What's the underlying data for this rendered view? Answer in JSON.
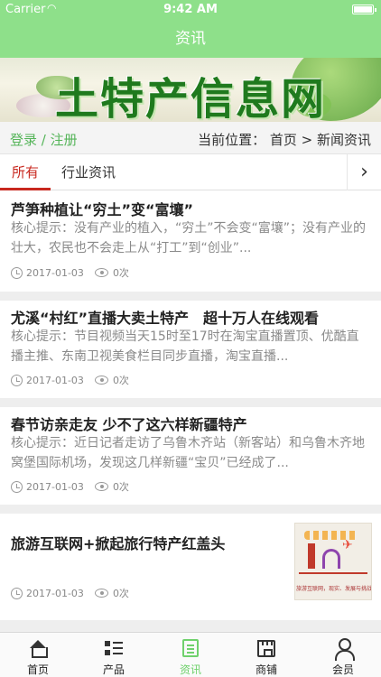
{
  "status_bar": {
    "carrier": "Carrier",
    "wifi_icon": "wifi-icon",
    "time": "9:42 AM",
    "battery_icon": "battery-icon"
  },
  "nav": {
    "title": "资讯"
  },
  "banner": {
    "text": "土特产信息网"
  },
  "subbar": {
    "login": "登录 / 注册",
    "breadcrumb": "当前位置： 首页 > 新闻资讯"
  },
  "tabs": {
    "items": [
      {
        "label": "所有",
        "active": true
      },
      {
        "label": "行业资讯",
        "active": false
      }
    ],
    "more_icon": "chevron-right-icon"
  },
  "articles": [
    {
      "title": "芦笋种植让“穷土”变“富壤”",
      "summary": "核心提示：没有产业的植入，“穷土”不会变“富壤”；没有产业的壮大，农民也不会走上从“打工”到“创业”...",
      "date": "2017-01-03",
      "views": "0次"
    },
    {
      "title": "尤溪“村红”直播大卖土特产　超十万人在线观看",
      "summary": "核心提示：节目视频当天15时至17时在淘宝直播置顶、优酷直播主推、东南卫视美食栏目同步直播，淘宝直播...",
      "date": "2017-01-03",
      "views": "0次"
    },
    {
      "title": "春节访亲走友 少不了这六样新疆特产",
      "summary": "核心提示：近日记者走访了乌鲁木齐站（新客站）和乌鲁木齐地窝堡国际机场，发现这几样新疆“宝贝”已经成了...",
      "date": "2017-01-03",
      "views": "0次"
    },
    {
      "title": "旅游互联网+掀起旅行特产红盖头",
      "date": "2017-01-03",
      "views": "0次",
      "thumb_caption": "旅游互联网，现实、发展与挑战"
    }
  ],
  "tabbar": {
    "items": [
      {
        "label": "首页",
        "icon": "home-icon",
        "active": false
      },
      {
        "label": "产品",
        "icon": "list-icon",
        "active": false
      },
      {
        "label": "资讯",
        "icon": "news-icon",
        "active": true
      },
      {
        "label": "商铺",
        "icon": "shop-icon",
        "active": false
      },
      {
        "label": "会员",
        "icon": "user-icon",
        "active": false
      }
    ]
  },
  "colors": {
    "theme_green": "#8ee08a",
    "link_green": "#56b55a",
    "active_red": "#c8281f",
    "tab_active_green": "#6fd16c"
  }
}
